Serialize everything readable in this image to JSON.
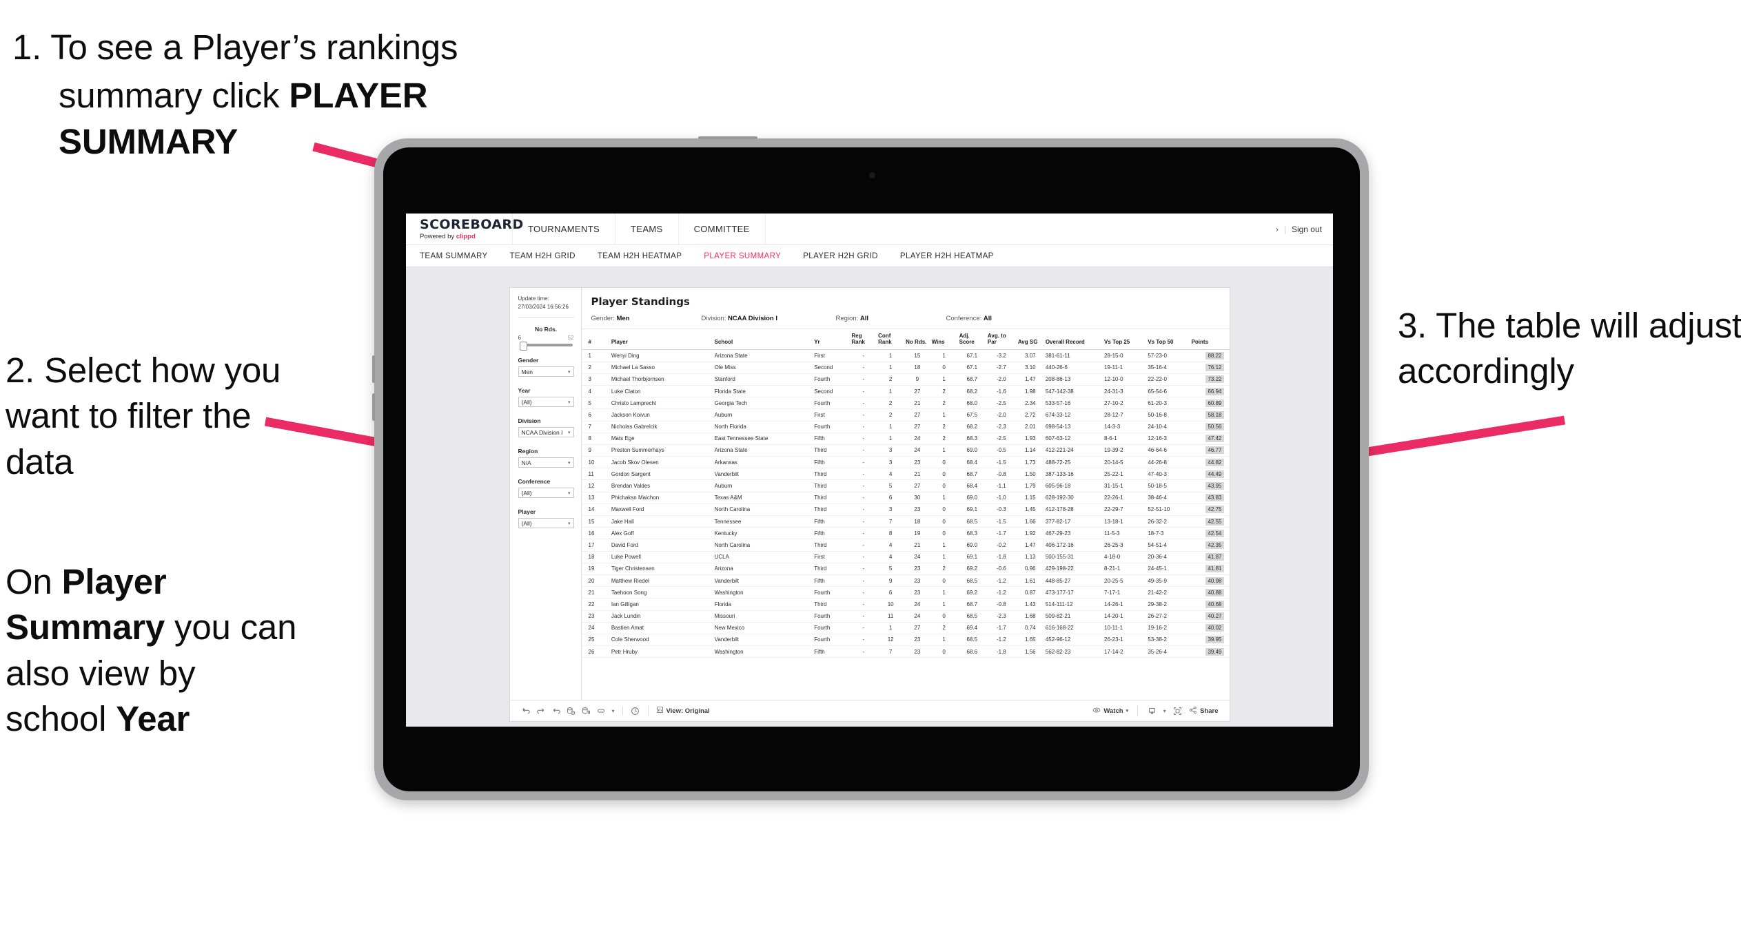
{
  "annotations": {
    "step1": {
      "number": "1.",
      "line1": "To see a Player’s rankings",
      "line2": "summary click ",
      "bold": "PLAYER SUMMARY"
    },
    "step2": {
      "text": "2. Select how you want to filter the data"
    },
    "step2b": {
      "prefix": "On ",
      "bold1": "Player Summary",
      "middle": " you can also view by school ",
      "bold2": "Year"
    },
    "step3": {
      "text": "3. The table will adjust accordingly"
    },
    "arrow_color": "#eb2b63"
  },
  "app": {
    "brand": {
      "name": "SCOREBOARD",
      "powered_prefix": "Powered by ",
      "powered_brand": "clippd"
    },
    "header_nav": [
      "TOURNAMENTS",
      "TEAMS",
      "COMMITTEE"
    ],
    "header_right": {
      "chevron": "›",
      "separator": "|",
      "sign_out": "Sign out"
    },
    "sub_nav": [
      {
        "label": "TEAM SUMMARY",
        "active": false
      },
      {
        "label": "TEAM H2H GRID",
        "active": false
      },
      {
        "label": "TEAM H2H HEATMAP",
        "active": false
      },
      {
        "label": "PLAYER SUMMARY",
        "active": true
      },
      {
        "label": "PLAYER H2H GRID",
        "active": false
      },
      {
        "label": "PLAYER H2H HEATMAP",
        "active": false
      }
    ],
    "accent_color": "#ef2e63"
  },
  "filters": {
    "update_time_label": "Update time:",
    "update_time_value": "27/03/2024 16:56:26",
    "no_rds": {
      "label": "No Rds.",
      "min": "6",
      "max": "52"
    },
    "selects": [
      {
        "label": "Gender",
        "value": "Men"
      },
      {
        "label": "Year",
        "value": "(All)"
      },
      {
        "label": "Division",
        "value": "NCAA Division I"
      },
      {
        "label": "Region",
        "value": "N/A"
      },
      {
        "label": "Conference",
        "value": "(All)"
      },
      {
        "label": "Player",
        "value": "(All)"
      }
    ],
    "caret": "▾"
  },
  "viz": {
    "title": "Player Standings",
    "filter_summary": [
      {
        "label": "Gender:",
        "value": "Men"
      },
      {
        "label": "Division:",
        "value": "NCAA Division I"
      },
      {
        "label": "Region:",
        "value": "All"
      },
      {
        "label": "Conference:",
        "value": "All"
      }
    ],
    "columns": [
      {
        "key": "rank",
        "header": "#"
      },
      {
        "key": "player",
        "header": "Player"
      },
      {
        "key": "school",
        "header": "School"
      },
      {
        "key": "yr",
        "header": "Yr"
      },
      {
        "key": "reg_rank",
        "header": "Reg Rank"
      },
      {
        "key": "conf_rank",
        "header": "Conf Rank"
      },
      {
        "key": "no_rds",
        "header": "No Rds."
      },
      {
        "key": "wins",
        "header": "Wins"
      },
      {
        "key": "adj_score",
        "header": "Adj. Score"
      },
      {
        "key": "avg_to_par",
        "header": "Avg. to Par"
      },
      {
        "key": "avg_sg",
        "header": "Avg SG"
      },
      {
        "key": "overall_record",
        "header": "Overall Record"
      },
      {
        "key": "vs_top_25",
        "header": "Vs Top 25"
      },
      {
        "key": "vs_top_50",
        "header": "Vs Top 50"
      },
      {
        "key": "points",
        "header": "Points"
      }
    ],
    "rows": [
      {
        "rank": "1",
        "player": "Wenyi Ding",
        "school": "Arizona State",
        "yr": "First",
        "reg_rank": "-",
        "conf_rank": "1",
        "no_rds": "15",
        "wins": "1",
        "adj_score": "67.1",
        "avg_to_par": "-3.2",
        "avg_sg": "3.07",
        "overall_record": "381-61-11",
        "vs_top_25": "28-15-0",
        "vs_top_50": "57-23-0",
        "points": "88.22"
      },
      {
        "rank": "2",
        "player": "Michael La Sasso",
        "school": "Ole Miss",
        "yr": "Second",
        "reg_rank": "-",
        "conf_rank": "1",
        "no_rds": "18",
        "wins": "0",
        "adj_score": "67.1",
        "avg_to_par": "-2.7",
        "avg_sg": "3.10",
        "overall_record": "440-26-6",
        "vs_top_25": "19-11-1",
        "vs_top_50": "35-16-4",
        "points": "76.12"
      },
      {
        "rank": "3",
        "player": "Michael Thorbjornsen",
        "school": "Stanford",
        "yr": "Fourth",
        "reg_rank": "-",
        "conf_rank": "2",
        "no_rds": "9",
        "wins": "1",
        "adj_score": "68.7",
        "avg_to_par": "-2.0",
        "avg_sg": "1.47",
        "overall_record": "208-86-13",
        "vs_top_25": "12-10-0",
        "vs_top_50": "22-22-0",
        "points": "73.22"
      },
      {
        "rank": "4",
        "player": "Luke Claton",
        "school": "Florida State",
        "yr": "Second",
        "reg_rank": "-",
        "conf_rank": "1",
        "no_rds": "27",
        "wins": "2",
        "adj_score": "68.2",
        "avg_to_par": "-1.6",
        "avg_sg": "1.98",
        "overall_record": "547-142-38",
        "vs_top_25": "24-31-3",
        "vs_top_50": "65-54-6",
        "points": "66.94"
      },
      {
        "rank": "5",
        "player": "Christo Lamprecht",
        "school": "Georgia Tech",
        "yr": "Fourth",
        "reg_rank": "-",
        "conf_rank": "2",
        "no_rds": "21",
        "wins": "2",
        "adj_score": "68.0",
        "avg_to_par": "-2.5",
        "avg_sg": "2.34",
        "overall_record": "533-57-16",
        "vs_top_25": "27-10-2",
        "vs_top_50": "61-20-3",
        "points": "60.89"
      },
      {
        "rank": "6",
        "player": "Jackson Koivun",
        "school": "Auburn",
        "yr": "First",
        "reg_rank": "-",
        "conf_rank": "2",
        "no_rds": "27",
        "wins": "1",
        "adj_score": "67.5",
        "avg_to_par": "-2.0",
        "avg_sg": "2.72",
        "overall_record": "674-33-12",
        "vs_top_25": "28-12-7",
        "vs_top_50": "50-16-8",
        "points": "58.18"
      },
      {
        "rank": "7",
        "player": "Nicholas Gabrelcik",
        "school": "North Florida",
        "yr": "Fourth",
        "reg_rank": "-",
        "conf_rank": "1",
        "no_rds": "27",
        "wins": "2",
        "adj_score": "68.2",
        "avg_to_par": "-2.3",
        "avg_sg": "2.01",
        "overall_record": "698-54-13",
        "vs_top_25": "14-3-3",
        "vs_top_50": "24-10-4",
        "points": "50.56"
      },
      {
        "rank": "8",
        "player": "Mats Ege",
        "school": "East Tennessee State",
        "yr": "Fifth",
        "reg_rank": "-",
        "conf_rank": "1",
        "no_rds": "24",
        "wins": "2",
        "adj_score": "68.3",
        "avg_to_par": "-2.5",
        "avg_sg": "1.93",
        "overall_record": "607-63-12",
        "vs_top_25": "8-6-1",
        "vs_top_50": "12-16-3",
        "points": "47.42"
      },
      {
        "rank": "9",
        "player": "Preston Summerhays",
        "school": "Arizona State",
        "yr": "Third",
        "reg_rank": "-",
        "conf_rank": "3",
        "no_rds": "24",
        "wins": "1",
        "adj_score": "69.0",
        "avg_to_par": "-0.5",
        "avg_sg": "1.14",
        "overall_record": "412-221-24",
        "vs_top_25": "19-39-2",
        "vs_top_50": "46-64-6",
        "points": "46.77"
      },
      {
        "rank": "10",
        "player": "Jacob Skov Olesen",
        "school": "Arkansas",
        "yr": "Fifth",
        "reg_rank": "-",
        "conf_rank": "3",
        "no_rds": "23",
        "wins": "0",
        "adj_score": "68.4",
        "avg_to_par": "-1.5",
        "avg_sg": "1.73",
        "overall_record": "488-72-25",
        "vs_top_25": "20-14-5",
        "vs_top_50": "44-26-8",
        "points": "44.82"
      },
      {
        "rank": "11",
        "player": "Gordon Sargent",
        "school": "Vanderbilt",
        "yr": "Third",
        "reg_rank": "-",
        "conf_rank": "4",
        "no_rds": "21",
        "wins": "0",
        "adj_score": "68.7",
        "avg_to_par": "-0.8",
        "avg_sg": "1.50",
        "overall_record": "387-133-16",
        "vs_top_25": "25-22-1",
        "vs_top_50": "47-40-3",
        "points": "44.49"
      },
      {
        "rank": "12",
        "player": "Brendan Valdes",
        "school": "Auburn",
        "yr": "Third",
        "reg_rank": "-",
        "conf_rank": "5",
        "no_rds": "27",
        "wins": "0",
        "adj_score": "68.4",
        "avg_to_par": "-1.1",
        "avg_sg": "1.79",
        "overall_record": "605-96-18",
        "vs_top_25": "31-15-1",
        "vs_top_50": "50-18-5",
        "points": "43.95"
      },
      {
        "rank": "13",
        "player": "Phichaksn Maichon",
        "school": "Texas A&M",
        "yr": "Third",
        "reg_rank": "-",
        "conf_rank": "6",
        "no_rds": "30",
        "wins": "1",
        "adj_score": "69.0",
        "avg_to_par": "-1.0",
        "avg_sg": "1.15",
        "overall_record": "628-192-30",
        "vs_top_25": "22-26-1",
        "vs_top_50": "38-46-4",
        "points": "43.83"
      },
      {
        "rank": "14",
        "player": "Maxwell Ford",
        "school": "North Carolina",
        "yr": "Third",
        "reg_rank": "-",
        "conf_rank": "3",
        "no_rds": "23",
        "wins": "0",
        "adj_score": "69.1",
        "avg_to_par": "-0.3",
        "avg_sg": "1.45",
        "overall_record": "412-178-28",
        "vs_top_25": "22-29-7",
        "vs_top_50": "52-51-10",
        "points": "42.75"
      },
      {
        "rank": "15",
        "player": "Jake Hall",
        "school": "Tennessee",
        "yr": "Fifth",
        "reg_rank": "-",
        "conf_rank": "7",
        "no_rds": "18",
        "wins": "0",
        "adj_score": "68.5",
        "avg_to_par": "-1.5",
        "avg_sg": "1.66",
        "overall_record": "377-82-17",
        "vs_top_25": "13-18-1",
        "vs_top_50": "26-32-2",
        "points": "42.55"
      },
      {
        "rank": "16",
        "player": "Alex Goff",
        "school": "Kentucky",
        "yr": "Fifth",
        "reg_rank": "-",
        "conf_rank": "8",
        "no_rds": "19",
        "wins": "0",
        "adj_score": "68.3",
        "avg_to_par": "-1.7",
        "avg_sg": "1.92",
        "overall_record": "467-29-23",
        "vs_top_25": "11-5-3",
        "vs_top_50": "18-7-3",
        "points": "42.54"
      },
      {
        "rank": "17",
        "player": "David Ford",
        "school": "North Carolina",
        "yr": "Third",
        "reg_rank": "-",
        "conf_rank": "4",
        "no_rds": "21",
        "wins": "1",
        "adj_score": "69.0",
        "avg_to_par": "-0.2",
        "avg_sg": "1.47",
        "overall_record": "406-172-16",
        "vs_top_25": "26-25-3",
        "vs_top_50": "54-51-4",
        "points": "42.35"
      },
      {
        "rank": "18",
        "player": "Luke Powell",
        "school": "UCLA",
        "yr": "First",
        "reg_rank": "-",
        "conf_rank": "4",
        "no_rds": "24",
        "wins": "1",
        "adj_score": "69.1",
        "avg_to_par": "-1.8",
        "avg_sg": "1.13",
        "overall_record": "500-155-31",
        "vs_top_25": "4-18-0",
        "vs_top_50": "20-36-4",
        "points": "41.87"
      },
      {
        "rank": "19",
        "player": "Tiger Christensen",
        "school": "Arizona",
        "yr": "Third",
        "reg_rank": "-",
        "conf_rank": "5",
        "no_rds": "23",
        "wins": "2",
        "adj_score": "69.2",
        "avg_to_par": "-0.6",
        "avg_sg": "0.96",
        "overall_record": "429-198-22",
        "vs_top_25": "8-21-1",
        "vs_top_50": "24-45-1",
        "points": "41.81"
      },
      {
        "rank": "20",
        "player": "Matthew Riedel",
        "school": "Vanderbilt",
        "yr": "Fifth",
        "reg_rank": "-",
        "conf_rank": "9",
        "no_rds": "23",
        "wins": "0",
        "adj_score": "68.5",
        "avg_to_par": "-1.2",
        "avg_sg": "1.61",
        "overall_record": "448-85-27",
        "vs_top_25": "20-25-5",
        "vs_top_50": "49-35-9",
        "points": "40.98"
      },
      {
        "rank": "21",
        "player": "Taehoon Song",
        "school": "Washington",
        "yr": "Fourth",
        "reg_rank": "-",
        "conf_rank": "6",
        "no_rds": "23",
        "wins": "1",
        "adj_score": "69.2",
        "avg_to_par": "-1.2",
        "avg_sg": "0.87",
        "overall_record": "473-177-17",
        "vs_top_25": "7-17-1",
        "vs_top_50": "21-42-2",
        "points": "40.88"
      },
      {
        "rank": "22",
        "player": "Ian Gilligan",
        "school": "Florida",
        "yr": "Third",
        "reg_rank": "-",
        "conf_rank": "10",
        "no_rds": "24",
        "wins": "1",
        "adj_score": "68.7",
        "avg_to_par": "-0.8",
        "avg_sg": "1.43",
        "overall_record": "514-111-12",
        "vs_top_25": "14-26-1",
        "vs_top_50": "29-38-2",
        "points": "40.68"
      },
      {
        "rank": "23",
        "player": "Jack Lundin",
        "school": "Missouri",
        "yr": "Fourth",
        "reg_rank": "-",
        "conf_rank": "11",
        "no_rds": "24",
        "wins": "0",
        "adj_score": "68.5",
        "avg_to_par": "-2.3",
        "avg_sg": "1.68",
        "overall_record": "509-82-21",
        "vs_top_25": "14-20-1",
        "vs_top_50": "26-27-2",
        "points": "40.27"
      },
      {
        "rank": "24",
        "player": "Bastien Amat",
        "school": "New Mexico",
        "yr": "Fourth",
        "reg_rank": "-",
        "conf_rank": "1",
        "no_rds": "27",
        "wins": "2",
        "adj_score": "69.4",
        "avg_to_par": "-1.7",
        "avg_sg": "0.74",
        "overall_record": "616-168-22",
        "vs_top_25": "10-11-1",
        "vs_top_50": "19-16-2",
        "points": "40.02"
      },
      {
        "rank": "25",
        "player": "Cole Sherwood",
        "school": "Vanderbilt",
        "yr": "Fourth",
        "reg_rank": "-",
        "conf_rank": "12",
        "no_rds": "23",
        "wins": "1",
        "adj_score": "68.5",
        "avg_to_par": "-1.2",
        "avg_sg": "1.65",
        "overall_record": "452-96-12",
        "vs_top_25": "26-23-1",
        "vs_top_50": "53-38-2",
        "points": "39.95"
      },
      {
        "rank": "26",
        "player": "Petr Hruby",
        "school": "Washington",
        "yr": "Fifth",
        "reg_rank": "-",
        "conf_rank": "7",
        "no_rds": "23",
        "wins": "0",
        "adj_score": "68.6",
        "avg_to_par": "-1.8",
        "avg_sg": "1.56",
        "overall_record": "562-82-23",
        "vs_top_25": "17-14-2",
        "vs_top_50": "35-26-4",
        "points": "39.49"
      }
    ]
  },
  "toolbar": {
    "view_label": "View: Original",
    "watch_label": "Watch",
    "share_label": "Share",
    "caret": "▾"
  }
}
